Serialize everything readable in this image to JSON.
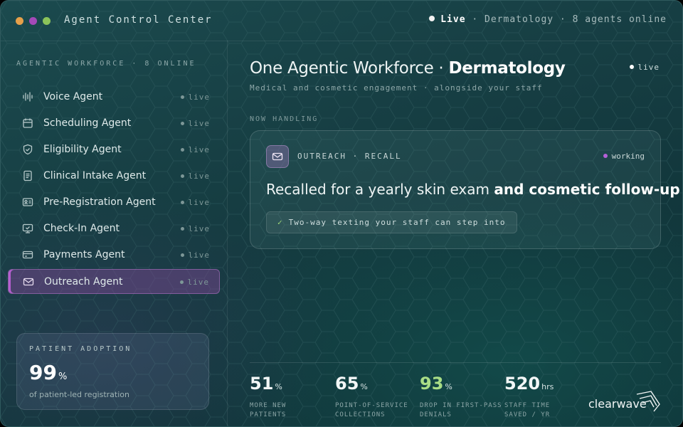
{
  "window": {
    "title": "Agent Control Center",
    "traffic_lights": [
      "#e6a04a",
      "#a449b8",
      "#8bc35a"
    ]
  },
  "status": {
    "live": "Live",
    "specialty": "· Dermatology ·",
    "agents_online": "8 agents online"
  },
  "sidebar": {
    "heading": "AGENTIC WORKFORCE · 8 ONLINE",
    "items": [
      {
        "label": "Voice Agent",
        "status": "live",
        "icon": "waveform-icon"
      },
      {
        "label": "Scheduling Agent",
        "status": "live",
        "icon": "calendar-icon"
      },
      {
        "label": "Eligibility Agent",
        "status": "live",
        "icon": "shield-check-icon"
      },
      {
        "label": "Clinical Intake Agent",
        "status": "live",
        "icon": "document-icon"
      },
      {
        "label": "Pre-Registration Agent",
        "status": "live",
        "icon": "id-card-icon"
      },
      {
        "label": "Check-In Agent",
        "status": "live",
        "icon": "monitor-icon"
      },
      {
        "label": "Payments Agent",
        "status": "live",
        "icon": "credit-card-icon"
      },
      {
        "label": "Outreach Agent",
        "status": "live",
        "icon": "mail-icon",
        "active": true
      }
    ],
    "adoption": {
      "title": "PATIENT ADOPTION",
      "value": "99",
      "unit": "%",
      "caption": "of patient-led registration"
    }
  },
  "main": {
    "title_light": "One Agentic Workforce · ",
    "title_bold": "Dermatology",
    "live_label": "live",
    "subtitle": "Medical and cosmetic engagement · alongside your staff",
    "now_label": "NOW HANDLING",
    "card": {
      "tag": "OUTREACH · RECALL",
      "state": "working",
      "headline_light": "Recalled for a yearly skin exam ",
      "headline_bold": "and cosmetic follow-up",
      "pill": "Two-way texting your staff can step into",
      "check": "✓"
    }
  },
  "stats": [
    {
      "value": "51",
      "unit": "%",
      "line1": "MORE NEW",
      "line2": "PATIENTS"
    },
    {
      "value": "65",
      "unit": "%",
      "line1": "POINT-OF-SERVICE",
      "line2": "COLLECTIONS"
    },
    {
      "value": "93",
      "unit": "%",
      "line1": "DROP IN FIRST-PASS",
      "line2": "DENIALS",
      "accent": "#a9dd86"
    },
    {
      "value": "520",
      "unit": "hrs",
      "line1": "STAFF TIME",
      "line2": "SAVED / YR"
    }
  ],
  "brand": {
    "name": "clearwave"
  }
}
